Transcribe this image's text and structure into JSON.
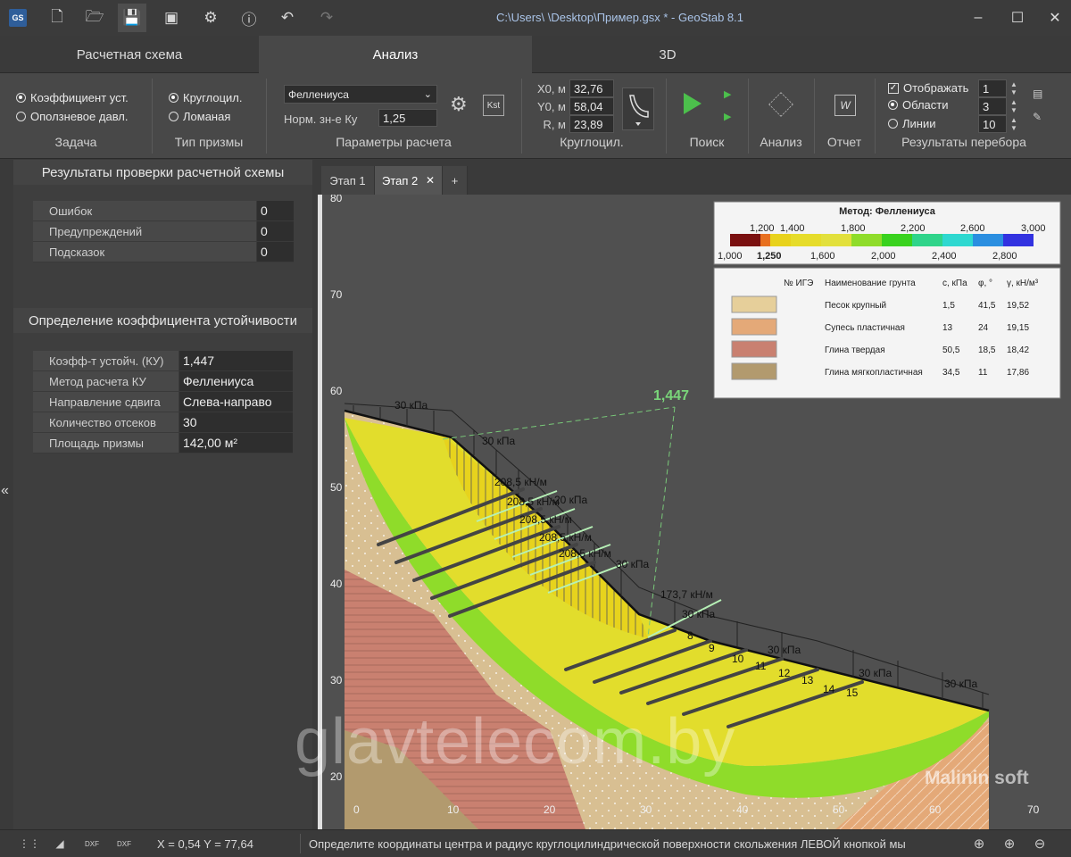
{
  "window": {
    "title": "C:\\Users\\            \\Desktop\\Пример.gsx * - GeoStab 8.1",
    "logo": "GS"
  },
  "main_tabs": [
    "Расчетная схема",
    "Анализ",
    "3D"
  ],
  "ribbon": {
    "task": {
      "label": "Задача",
      "options": [
        "Коэффициент уст.",
        "Оползневое давл."
      ],
      "selected": 0
    },
    "prism": {
      "label": "Тип призмы",
      "options": [
        "Круглоцил.",
        "Ломаная"
      ],
      "selected": 0
    },
    "params": {
      "label": "Параметры расчета",
      "method": "Феллениуса",
      "norm_label": "Норм. зн-е Ку",
      "norm_value": "1,25",
      "kst_label": "Kst"
    },
    "circ": {
      "label": "Круглоцил.",
      "x0_label": "X0, м",
      "x0": "32,76",
      "y0_label": "Y0, м",
      "y0": "58,04",
      "r_label": "R, м",
      "r": "23,89"
    },
    "search_label": "Поиск",
    "analysis_label": "Анализ",
    "report_label": "Отчет",
    "results": {
      "label": "Результаты перебора",
      "show_label": "Отображать",
      "show_value": "1",
      "areas_label": "Области",
      "areas_value": "3",
      "lines_label": "Линии",
      "lines_value": "10"
    }
  },
  "panel": {
    "check_title": "Результаты проверки расчетной схемы",
    "check_rows": [
      {
        "key": "Ошибок",
        "value": "0"
      },
      {
        "key": "Предупреждений",
        "value": "0"
      },
      {
        "key": "Подсказок",
        "value": "0"
      }
    ],
    "ku_title": "Определение коэффициента устойчивости",
    "ku_rows": [
      {
        "key": "Коэфф-т устойч. (КУ)",
        "value": "1,447"
      },
      {
        "key": "Метод расчета КУ",
        "value": "Феллениуса"
      },
      {
        "key": "Направление сдвига",
        "value": "Слева-направо"
      },
      {
        "key": "Количество отсеков",
        "value": "30"
      },
      {
        "key": "Площадь призмы",
        "value": "142,00 м²"
      }
    ]
  },
  "stage_tabs": [
    "Этап 1",
    "Этап 2",
    "+"
  ],
  "canvas": {
    "fs_value": "1,447",
    "y_ticks": [
      "80",
      "70",
      "60",
      "50",
      "40",
      "30",
      "20"
    ],
    "x_ticks": [
      "0",
      "10",
      "20",
      "30",
      "40",
      "50",
      "60",
      "70"
    ],
    "loads": [
      "30 кПа",
      "30 кПа",
      "20 кПа",
      "30 кПа",
      "30 кПа",
      "30 кПа",
      "30 кПа",
      "30 кПа"
    ],
    "anchor_forces": [
      "208,5 кН/м",
      "208,5 кН/м",
      "208,5 кН/м",
      "208,5 кН/м",
      "208,5 кН/м",
      "173,7 кН/м"
    ],
    "slice_numbers": [
      "8",
      "9",
      "10",
      "11",
      "12",
      "13",
      "14",
      "15"
    ],
    "legend": {
      "method": "Метод: Феллениуса",
      "top_ticks": [
        "1,200",
        "1,400",
        "1,800",
        "2,200",
        "2,600",
        "3,000"
      ],
      "bottom_ticks": [
        "1,000",
        "1,250",
        "1,600",
        "2,000",
        "2,400",
        "2,800"
      ],
      "colors": [
        "#7a1010",
        "#e8701f",
        "#e8d21c",
        "#e6dc2a",
        "#e2e03c",
        "#8fdc2a",
        "#39d21e",
        "#2fd48a",
        "#2ed8d0",
        "#2a8ee0",
        "#3232e0"
      ]
    },
    "soils": {
      "headers": [
        "№ ИГЭ",
        "Наименование грунта",
        "c, кПа",
        "φ, °",
        "γ, кН/м³"
      ],
      "rows": [
        {
          "name": "Песок крупный",
          "c": "1,5",
          "phi": "41,5",
          "gamma": "19,52",
          "color": "#e6cf9a"
        },
        {
          "name": "Супесь пластичная",
          "c": "13",
          "phi": "24",
          "gamma": "19,15",
          "color": "#e4a978"
        },
        {
          "name": "Глина твердая",
          "c": "50,5",
          "phi": "18,5",
          "gamma": "18,42",
          "color": "#c98070"
        },
        {
          "name": "Глина мягкопластичная",
          "c": "34,5",
          "phi": "11",
          "gamma": "17,86",
          "color": "#b29a6e"
        }
      ]
    }
  },
  "status": {
    "coords": "X = 0,54  Y = 77,64",
    "hint": "Определите координаты центра и радиус круглоцилиндрической поверхности скольжения ЛЕВОЙ кнопкой мы"
  },
  "watermark": "glavtelecom.by",
  "brand": "Malinin soft"
}
